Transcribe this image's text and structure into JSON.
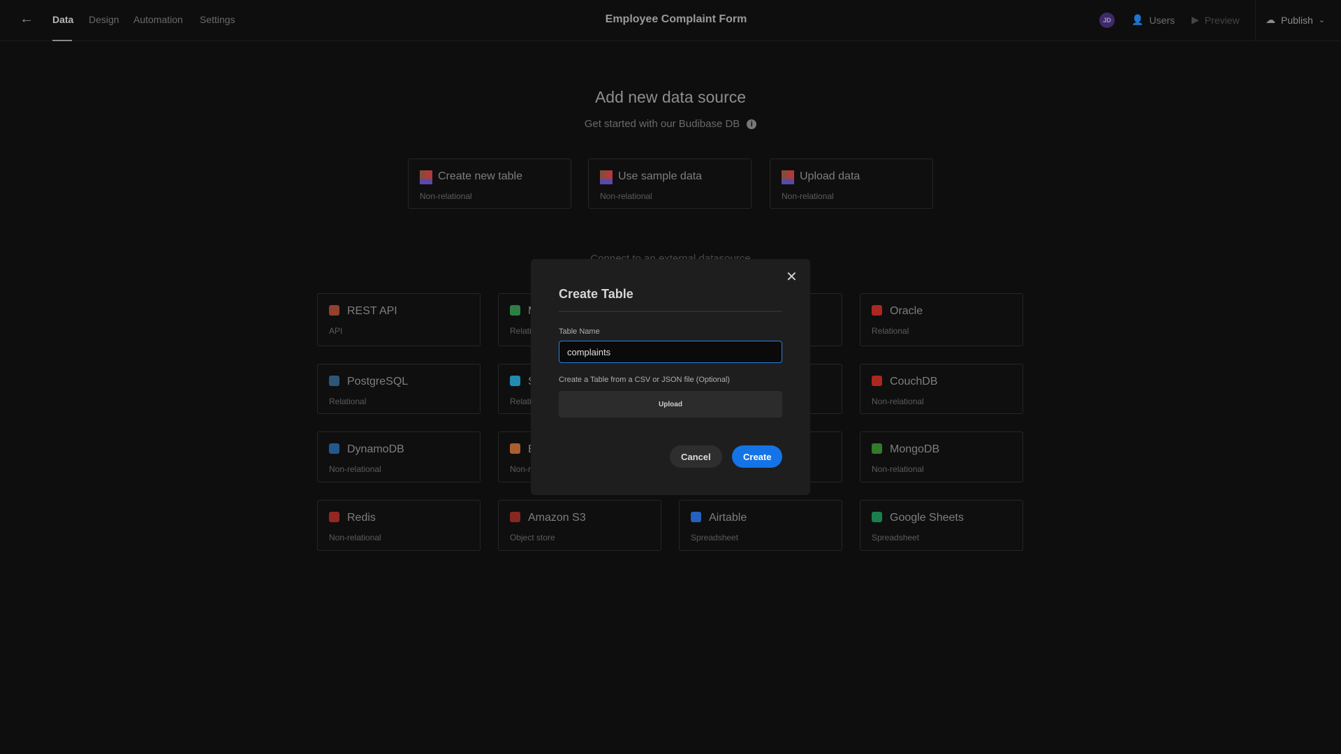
{
  "header": {
    "tabs": [
      {
        "label": "Data",
        "active": true
      },
      {
        "label": "Design"
      },
      {
        "label": "Automation"
      },
      {
        "label": "Settings"
      }
    ],
    "title": "Employee Complaint Form",
    "avatar_initials": "JD",
    "users_label": "Users",
    "preview_label": "Preview",
    "publish_label": "Publish"
  },
  "main": {
    "title": "Add new data source",
    "subtitle": "Get started with our Budibase DB",
    "internal_cards": [
      {
        "name": "Create new table",
        "type": "Non-relational"
      },
      {
        "name": "Use sample data",
        "type": "Non-relational"
      },
      {
        "name": "Upload data",
        "type": "Non-relational"
      }
    ],
    "external_heading": "Connect to an external datasource",
    "external_cards": [
      {
        "name": "REST API",
        "type": "API",
        "icon": "rest-api-icon",
        "color": "#c0513a"
      },
      {
        "name": "Microsoft SQL Server",
        "type": "Relational",
        "icon": "mssql-icon",
        "color": "#3aa655"
      },
      {
        "name": "",
        "type": "",
        "icon": "",
        "color": ""
      },
      {
        "name": "Oracle",
        "type": "Relational",
        "icon": "oracle-icon",
        "color": "#e0302a"
      },
      {
        "name": "PostgreSQL",
        "type": "Relational",
        "icon": "postgresql-icon",
        "color": "#3a6f9a"
      },
      {
        "name": "Snowflake",
        "type": "Relational",
        "icon": "snowflake-icon",
        "color": "#29b5e8"
      },
      {
        "name": "",
        "type": "",
        "icon": "",
        "color": ""
      },
      {
        "name": "CouchDB",
        "type": "Non-relational",
        "icon": "couchdb-icon",
        "color": "#e0302a"
      },
      {
        "name": "DynamoDB",
        "type": "Non-relational",
        "icon": "dynamodb-icon",
        "color": "#2a73b8"
      },
      {
        "name": "Elasticsearch",
        "type": "Non-relational",
        "icon": "elasticsearch-icon",
        "color": "#e07a3a"
      },
      {
        "name": "",
        "type": "",
        "icon": "",
        "color": ""
      },
      {
        "name": "MongoDB",
        "type": "Non-relational",
        "icon": "mongodb-icon",
        "color": "#3fa037"
      },
      {
        "name": "Redis",
        "type": "Non-relational",
        "icon": "redis-icon",
        "color": "#c3302a"
      },
      {
        "name": "Amazon S3",
        "type": "Object store",
        "icon": "amazon-s3-icon",
        "color": "#b0302a"
      },
      {
        "name": "Airtable",
        "type": "Spreadsheet",
        "icon": "airtable-icon",
        "color": "#2d7ff9"
      },
      {
        "name": "Google Sheets",
        "type": "Spreadsheet",
        "icon": "google-sheets-icon",
        "color": "#1fa463"
      }
    ]
  },
  "modal": {
    "title": "Create Table",
    "table_name_label": "Table Name",
    "table_name_value": "complaints",
    "file_label": "Create a Table from a CSV or JSON file (Optional)",
    "upload_label": "Upload",
    "cancel_label": "Cancel",
    "create_label": "Create"
  },
  "colors": {
    "accent": "#1473e6",
    "input_focus": "#2680eb",
    "avatar": "#3e2a6a"
  }
}
